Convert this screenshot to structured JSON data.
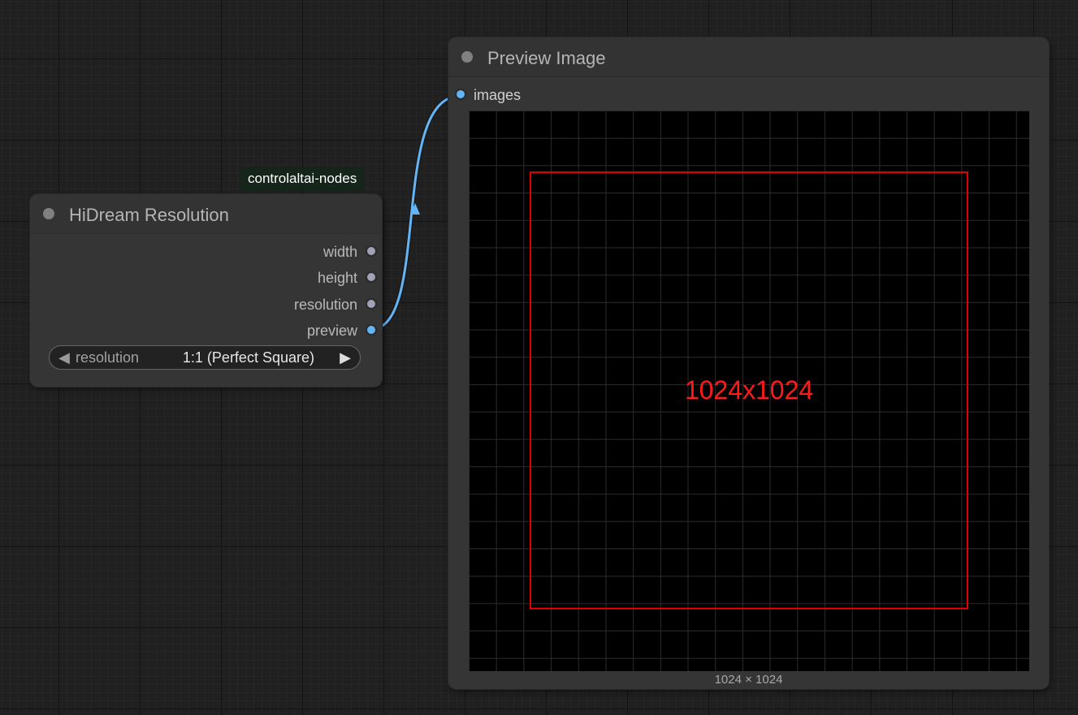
{
  "hidream_node": {
    "badge": "controlaltai-nodes",
    "title": "HiDream Resolution",
    "outputs": [
      "width",
      "height",
      "resolution",
      "preview"
    ],
    "widget": {
      "name": "resolution",
      "value": "1:1 (Perfect Square)",
      "left_arrow": "◀",
      "right_arrow": "▶"
    }
  },
  "preview_node": {
    "title": "Preview Image",
    "input": "images",
    "image_label": "1024x1024",
    "dimensions": "1024 × 1024"
  },
  "colors": {
    "link": "#64b5f6",
    "slot_default": "#a2a2b6",
    "image_outline": "#e00000",
    "badge_bg": "#15251a"
  },
  "icons": {
    "title_dot": "circle-dot-icon",
    "slot": "slot-circle-icon"
  }
}
